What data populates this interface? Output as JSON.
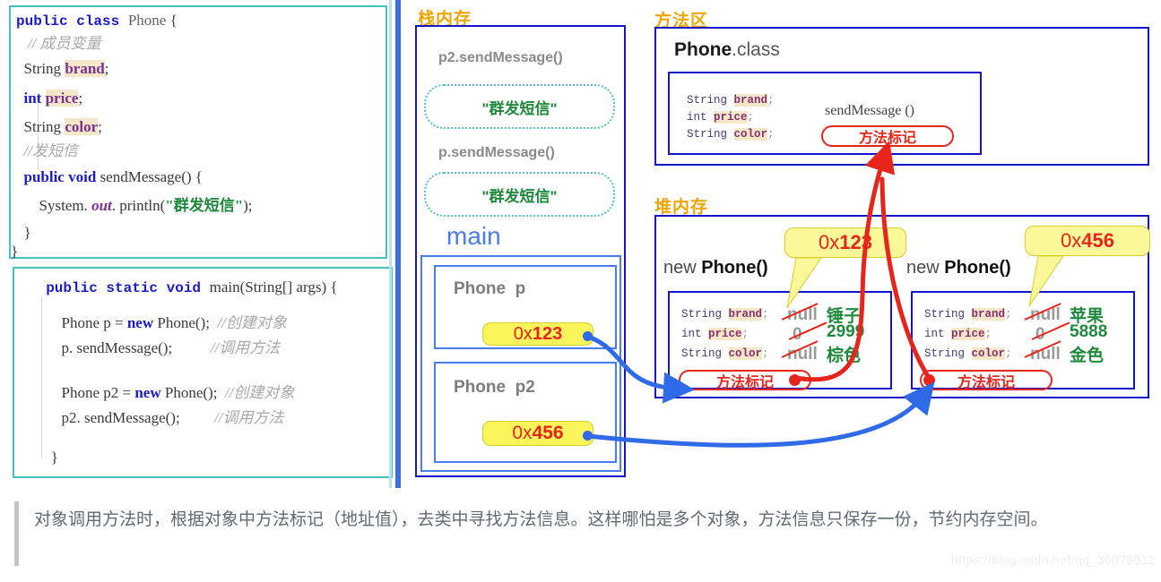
{
  "code_panel": {
    "class_block": {
      "lines": [
        {
          "id": "l1",
          "segments": [
            {
              "t": "public class ",
              "c": "kw"
            },
            {
              "t": "Phone",
              "c": "cls"
            },
            {
              "t": " {",
              "c": "plain"
            }
          ]
        },
        {
          "id": "l2",
          "segments": [
            {
              "t": "   // 成员变量",
              "c": "cmt"
            }
          ]
        },
        {
          "id": "l3",
          "segments": [
            {
              "t": "  String ",
              "c": "plain"
            },
            {
              "t": "brand",
              "c": "fld"
            },
            {
              "t": ";",
              "c": "plain"
            }
          ]
        },
        {
          "id": "l4",
          "segments": [
            {
              "t": "  ",
              "c": "plain"
            },
            {
              "t": "int ",
              "c": "kw2"
            },
            {
              "t": "price",
              "c": "fld"
            },
            {
              "t": ";",
              "c": "plain"
            }
          ]
        },
        {
          "id": "l5",
          "segments": [
            {
              "t": "  String ",
              "c": "plain"
            },
            {
              "t": "color",
              "c": "fld"
            },
            {
              "t": ";",
              "c": "plain"
            }
          ]
        },
        {
          "id": "l6",
          "segments": [
            {
              "t": "  //发短信",
              "c": "cmt"
            }
          ]
        },
        {
          "id": "l7",
          "segments": [
            {
              "t": "  public void ",
              "c": "kw2"
            },
            {
              "t": "sendMessage() {",
              "c": "plain"
            }
          ]
        },
        {
          "id": "l8",
          "segments": [
            {
              "t": "      System. ",
              "c": "plain"
            },
            {
              "t": "out",
              "c": "ital"
            },
            {
              "t": ". println(",
              "c": "plain"
            },
            {
              "t": "\"群发短信\"",
              "c": "str"
            },
            {
              "t": ");",
              "c": "plain"
            }
          ]
        },
        {
          "id": "l9",
          "segments": [
            {
              "t": "  }",
              "c": "plain"
            }
          ]
        },
        {
          "id": "l10",
          "segments": [
            {
              "t": "}",
              "c": "plain"
            }
          ]
        }
      ]
    },
    "main_block": {
      "lines": [
        {
          "id": "m1",
          "segments": [
            {
              "t": "  public static void ",
              "c": "kw"
            },
            {
              "t": "main(String[] args) {",
              "c": "plain"
            }
          ]
        },
        {
          "id": "m2",
          "segments": [
            {
              "t": "  Phone p = ",
              "c": "plain"
            },
            {
              "t": "new ",
              "c": "kw2"
            },
            {
              "t": "Phone();  ",
              "c": "plain"
            },
            {
              "t": "//创建对象",
              "c": "cmt"
            }
          ]
        },
        {
          "id": "m3",
          "segments": [
            {
              "t": "  p. sendMessage();          ",
              "c": "plain"
            },
            {
              "t": "//调用方法",
              "c": "cmt"
            }
          ]
        },
        {
          "id": "m4",
          "segments": [
            {
              "t": "  Phone p2 = ",
              "c": "plain"
            },
            {
              "t": "new ",
              "c": "kw2"
            },
            {
              "t": "Phone();  ",
              "c": "plain"
            },
            {
              "t": "//创建对象",
              "c": "cmt"
            }
          ]
        },
        {
          "id": "m5",
          "segments": [
            {
              "t": "  p2. sendMessage();         ",
              "c": "cmt2"
            },
            {
              "t": "//调用方法",
              "c": "cmt"
            }
          ]
        },
        {
          "id": "m6",
          "segments": [
            {
              "t": "   }",
              "c": "plain"
            }
          ]
        }
      ]
    }
  },
  "stack": {
    "title": "栈内存",
    "frames": [
      {
        "call": "p2.sendMessage()",
        "output": "\"群发短信\""
      },
      {
        "call": "p.sendMessage()",
        "output": "\"群发短信\""
      }
    ],
    "main_label": "main",
    "variables": [
      {
        "type": "Phone",
        "name": "p",
        "addr_prefix": "0x",
        "addr_value": "123"
      },
      {
        "type": "Phone",
        "name": "p2",
        "addr_prefix": "0x",
        "addr_value": "456"
      }
    ]
  },
  "method_area": {
    "title": "方法区",
    "class_name": "Phone",
    "class_suffix": ".class",
    "fields": [
      {
        "type": "String",
        "name": "brand",
        "sep": ";"
      },
      {
        "type": "int",
        "name": "price",
        "sep": ";"
      },
      {
        "type": "String",
        "name": "color",
        "sep": ";"
      }
    ],
    "method_name": "sendMessage ()",
    "method_tag": "方法标记"
  },
  "heap": {
    "title": "堆内存",
    "objects": [
      {
        "label_prefix": "new ",
        "label_name": "Phone()",
        "callout_prefix": "0x",
        "callout_value": "123",
        "fields": [
          {
            "type": "String",
            "name": "brand",
            "sep": ";",
            "old": "null",
            "new": "锤子"
          },
          {
            "type": "int",
            "name": "price",
            "sep": ";",
            "old": "0",
            "new": "2999"
          },
          {
            "type": "String",
            "name": "color",
            "sep": ";",
            "old": "null",
            "new": "棕色"
          }
        ],
        "method_tag": "方法标记"
      },
      {
        "label_prefix": "new ",
        "label_name": "Phone()",
        "callout_prefix": "0x",
        "callout_value": "456",
        "fields": [
          {
            "type": "String",
            "name": "brand",
            "sep": ";",
            "old": "null",
            "new": "苹果"
          },
          {
            "type": "int",
            "name": "price",
            "sep": ";",
            "old": "0",
            "new": "5888"
          },
          {
            "type": "String",
            "name": "color",
            "sep": ";",
            "old": "null",
            "new": "金色"
          }
        ],
        "method_tag": "方法标记"
      }
    ]
  },
  "caption": {
    "text": "对象调用方法时，根据对象中方法标记（地址值），去类中寻找方法信息。这样哪怕是多个对象，方法信息只保存一份，节约内存空间。"
  },
  "watermark": {
    "text": "https://blog.csdn.net/qq_36079912"
  },
  "colors": {
    "stack_border": "#1414c8",
    "frame_border": "#4a7bf0",
    "heading": "#f0a500",
    "address_chip_bg": "#fbf55c",
    "address_text": "#e8251b",
    "value_new": "#1f8a3b",
    "value_old": "#9a9a9a",
    "arrow_blue": "#2f6ae8",
    "arrow_red": "#e8251b",
    "code_border": "#43c2bf"
  }
}
